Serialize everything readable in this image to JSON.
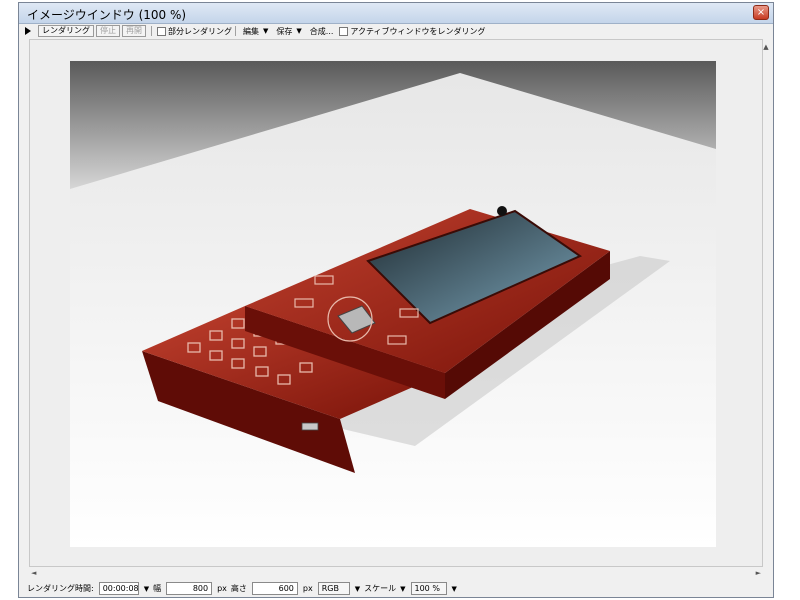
{
  "window": {
    "title": "イメージウインドウ (100 %)",
    "close_glyph": "×"
  },
  "toolbar": {
    "render_label": "レンダリング",
    "stop_label": "停止",
    "redraw_label": "再開",
    "partial_render_label": "部分レンダリング",
    "edit_label": "編集",
    "save_label": "保存",
    "composite_label": "合成...",
    "active_window_render_label": "アクティブウィンドウをレンダリング"
  },
  "canvas": {
    "image_subject": "red slide mobile phone 3D render"
  },
  "statusbar": {
    "render_time_label": "レンダリング時間:",
    "render_time_value": "00:00:08",
    "width_label": "幅",
    "width_value": "800",
    "width_unit": "px",
    "height_label": "高さ",
    "height_value": "600",
    "height_unit": "px",
    "color_mode_value": "RGB",
    "scale_label": "スケール",
    "zoom_value": "100 %"
  },
  "colors": {
    "phone_red": "#8e1a12",
    "title_gradient_top": "#dfe9f5"
  }
}
